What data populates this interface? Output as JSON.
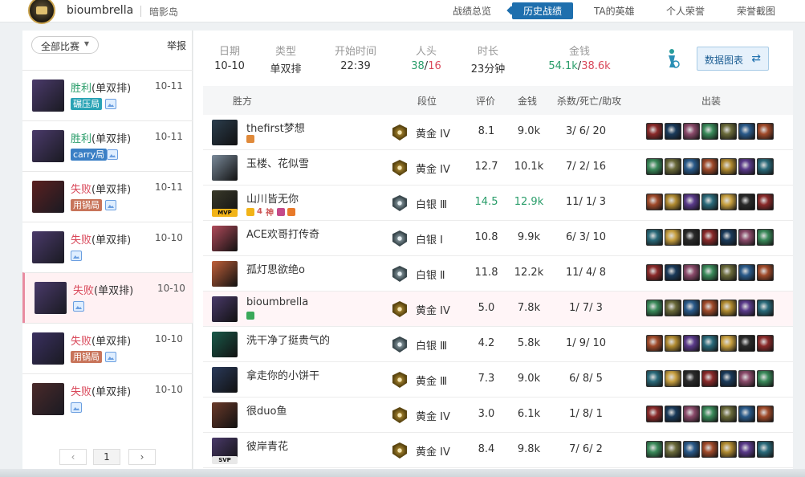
{
  "header": {
    "username": "bioumbrella",
    "region": "暗影岛",
    "nav": [
      "战绩总览",
      "历史战绩",
      "TA的英雄",
      "个人荣誉",
      "荣誉截图"
    ],
    "active_nav": "历史战绩"
  },
  "left": {
    "filter": "全部比赛",
    "report": "举报",
    "matches": [
      {
        "result": "胜利",
        "mode": "(单双排)",
        "date": "10-11",
        "tag": "碾压局",
        "tag_color": "#2aa3b5",
        "champ_color": "#4a3a6a",
        "outcome": "win"
      },
      {
        "result": "胜利",
        "mode": "(单双排)",
        "date": "10-11",
        "tag": "carry局",
        "tag_color": "#3a7fc5",
        "champ_color": "#4a3a6a",
        "outcome": "win"
      },
      {
        "result": "失败",
        "mode": "(单双排)",
        "date": "10-11",
        "tag": "用锅局",
        "tag_color": "#c8745a",
        "champ_color": "#5a2020",
        "outcome": "lose"
      },
      {
        "result": "失败",
        "mode": "(单双排)",
        "date": "10-10",
        "tag": "",
        "tag_color": "",
        "champ_color": "#4a3a6a",
        "outcome": "lose"
      },
      {
        "result": "失败",
        "mode": "(单双排)",
        "date": "10-10",
        "tag": "",
        "tag_color": "",
        "champ_color": "#4a3a6a",
        "outcome": "lose"
      },
      {
        "result": "失败",
        "mode": "(单双排)",
        "date": "10-10",
        "tag": "用锅局",
        "tag_color": "#c8745a",
        "champ_color": "#3a3060",
        "outcome": "lose"
      },
      {
        "result": "失败",
        "mode": "(单双排)",
        "date": "10-10",
        "tag": "",
        "tag_color": "",
        "champ_color": "#4a2a2a",
        "outcome": "lose"
      }
    ],
    "pager": {
      "prev": "‹",
      "page": "1",
      "next": "›"
    }
  },
  "summary": {
    "date_label": "日期",
    "date": "10-10",
    "type_label": "类型",
    "type": "单双排",
    "start_label": "开始时间",
    "start": "22:39",
    "kills_label": "人头",
    "kills_win": "38",
    "kills_sep": "/",
    "kills_lose": "16",
    "duration_label": "时长",
    "duration": "23分钟",
    "gold_label": "金钱",
    "gold_win": "54.1k",
    "gold_sep": "/",
    "gold_lose": "38.6k",
    "chart_button": "数据图表"
  },
  "table": {
    "headers": {
      "side": "胜方",
      "tier": "段位",
      "score": "评价",
      "gold": "金钱",
      "kda": "杀数/死亡/助攻",
      "items": "出装"
    },
    "players": [
      {
        "name": "thefirst梦想",
        "tier": "黄金 IV",
        "rank_type": "gold",
        "score": "8.1",
        "gold": "9.0k",
        "kda": "3/ 6/ 20",
        "champ_color": "#2c3e4e",
        "badge": "",
        "highlight": false,
        "badges": [
          "#e08a3a"
        ]
      },
      {
        "name": "玉楼、花似雪",
        "tier": "黄金 IV",
        "rank_type": "gold",
        "score": "12.7",
        "gold": "10.1k",
        "kda": "7/ 2/ 16",
        "champ_color": "#7a8a9a",
        "badge": "",
        "highlight": false,
        "badges": []
      },
      {
        "name": "山川皆无你",
        "tier": "白银 Ⅲ",
        "rank_type": "silver",
        "score": "14.5",
        "gold": "12.9k",
        "kda": "11/ 1/ 3",
        "champ_color": "#3a3a2a",
        "badge": "MVP",
        "highlight": true,
        "badges": [
          "#f2b418"
        ],
        "badge_text": [
          "4",
          "神"
        ]
      },
      {
        "name": "ACE欢哥打传奇",
        "tier": "白银 Ⅰ",
        "rank_type": "silver",
        "score": "10.8",
        "gold": "9.9k",
        "kda": "6/ 3/ 10",
        "champ_color": "#b04a5a",
        "badge": "",
        "highlight": false,
        "badges": []
      },
      {
        "name": "孤灯思欲绝o",
        "tier": "白银 Ⅱ",
        "rank_type": "silver",
        "score": "11.8",
        "gold": "12.2k",
        "kda": "11/ 4/ 8",
        "champ_color": "#c0603a",
        "badge": "",
        "highlight": false,
        "badges": []
      },
      {
        "name": "bioumbrella",
        "tier": "黄金 IV",
        "rank_type": "gold",
        "score": "5.0",
        "gold": "7.8k",
        "kda": "1/ 7/ 3",
        "champ_color": "#4a3a6a",
        "badge": "",
        "highlight": false,
        "badges": [
          "#3aa95a"
        ],
        "me": true
      },
      {
        "name": "洗干净了挺贵气的",
        "tier": "白银 Ⅲ",
        "rank_type": "silver",
        "score": "4.2",
        "gold": "5.8k",
        "kda": "1/ 9/ 10",
        "champ_color": "#1a5a4a",
        "badge": "",
        "highlight": false,
        "badges": []
      },
      {
        "name": "拿走你的小饼干",
        "tier": "黄金 Ⅲ",
        "rank_type": "gold",
        "score": "7.3",
        "gold": "9.0k",
        "kda": "6/ 8/ 5",
        "champ_color": "#2a3a5a",
        "badge": "",
        "highlight": false,
        "badges": []
      },
      {
        "name": "很duo鱼",
        "tier": "黄金 IV",
        "rank_type": "gold",
        "score": "3.0",
        "gold": "6.1k",
        "kda": "1/ 8/ 1",
        "champ_color": "#6a3a2a",
        "badge": "",
        "highlight": false,
        "badges": []
      },
      {
        "name": "彼岸青花",
        "tier": "黄金 IV",
        "rank_type": "gold",
        "score": "8.4",
        "gold": "9.8k",
        "kda": "7/ 6/ 2",
        "champ_color": "#4a3a6a",
        "badge": "SVP",
        "highlight": false,
        "badges": []
      }
    ]
  },
  "colors": {
    "accent": "#1e6fae",
    "win": "#2a9d6a",
    "lose": "#d9485a"
  },
  "icons": [
    "crest-icon",
    "dropdown-caret-icon",
    "screenshot-icon",
    "figure-icon",
    "swap-arrows-icon",
    "rank-emblem-icon",
    "item-icon"
  ]
}
